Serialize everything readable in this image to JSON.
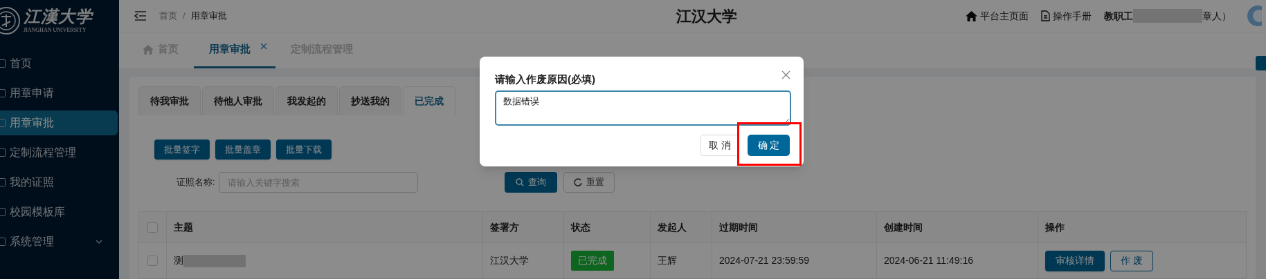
{
  "sidebar": {
    "logo": {
      "title": "江漢大学",
      "subtitle": "JIANGHAN UNIVERSITY"
    },
    "items": [
      {
        "label": "首页",
        "selected": false
      },
      {
        "label": "用章申请",
        "selected": false
      },
      {
        "label": "用章审批",
        "selected": true
      },
      {
        "label": "定制流程管理",
        "selected": false
      },
      {
        "label": "我的证照",
        "selected": false
      },
      {
        "label": "校园模板库",
        "selected": false
      },
      {
        "label": "系统管理",
        "selected": false,
        "expanded": false
      }
    ]
  },
  "header": {
    "breadcrumb": [
      "首页",
      "用章审批"
    ],
    "breadcrumb_separator": "/",
    "title": "江汉大学",
    "links": [
      "平台主页面",
      "操作手册"
    ],
    "user": {
      "name": "教职工",
      "suffix": "章人）"
    }
  },
  "page_tabs": [
    {
      "label": "首页",
      "selected": false,
      "closable": false
    },
    {
      "label": "用章审批",
      "selected": true,
      "closable": true
    },
    {
      "label": "定制流程管理",
      "selected": false,
      "closable": false
    }
  ],
  "sub_tabs": [
    {
      "label": "待我审批",
      "selected": false
    },
    {
      "label": "待他人审批",
      "selected": false
    },
    {
      "label": "我发起的",
      "selected": false
    },
    {
      "label": "抄送我的",
      "selected": false
    },
    {
      "label": "已完成",
      "selected": true
    }
  ],
  "batch_buttons": [
    "批量签字",
    "批量盖章",
    "批量下载"
  ],
  "search": {
    "label": "证照名称:",
    "placeholder": "请输入关键字搜索",
    "query": "查询",
    "reset": "重置"
  },
  "table": {
    "all_checked": false,
    "columns": [
      "主题",
      "签署方",
      "状态",
      "发起人",
      "过期时间",
      "创建时间",
      "操作"
    ],
    "rows": [
      {
        "checked": false,
        "subject": "测",
        "signer": "江汉大学",
        "status": "已完成",
        "initiator": "王辉",
        "expires": "2024-07-21 23:59:59",
        "created": "2024-06-21 11:49:16",
        "actions": [
          "审核详情",
          "作 废"
        ]
      }
    ]
  },
  "dialog": {
    "title": "请输入作废原因(必填)",
    "value": "数据错误",
    "cancel": "取 消",
    "confirm": "确 定"
  }
}
